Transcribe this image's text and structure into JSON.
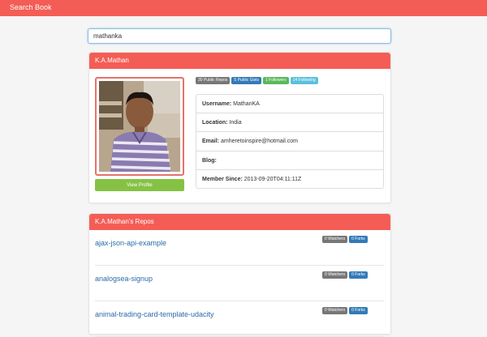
{
  "navbar": {
    "brand": "Search Book"
  },
  "search": {
    "value": "mathanka"
  },
  "user": {
    "name": "K.A.Mathan",
    "badges": [
      "30 Public Repos",
      "5 Public Gists",
      "1 Followers",
      "14 Following"
    ],
    "info": [
      {
        "label": "Username:",
        "value": "MathanKA"
      },
      {
        "label": "Location:",
        "value": "India"
      },
      {
        "label": "Email:",
        "value": "amheretoinspire@hotmail.com"
      },
      {
        "label": "Blog:",
        "value": ""
      },
      {
        "label": "Member Since:",
        "value": "2013-09-20T04:11:11Z"
      }
    ],
    "view_profile_label": "View Profile"
  },
  "repos": {
    "heading": "K.A.Mathan's Repos",
    "items": [
      {
        "name": "ajax-json-api-example",
        "watchers": "0 Watchers",
        "forks": "0 Forks"
      },
      {
        "name": "analogsea-signup",
        "watchers": "0 Watchers",
        "forks": "0 Forks"
      },
      {
        "name": "animal-trading-card-template-udacity",
        "watchers": "0 Watchers",
        "forks": "0 Forks"
      }
    ]
  },
  "colors": {
    "accent": "#f45d55",
    "view_profile": "#85c244",
    "link": "#2b6ba8"
  }
}
